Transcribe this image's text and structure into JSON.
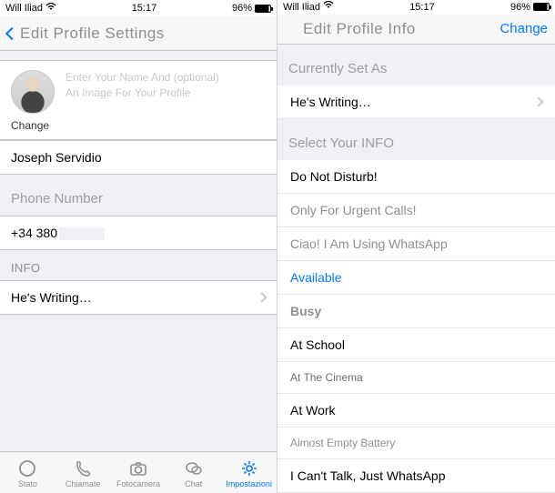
{
  "status": {
    "carrier": "Will Iliad",
    "time": "15:17",
    "battery_pct": "96%"
  },
  "left": {
    "nav_title": "Edit Profile Settings",
    "profile_placeholder_line1": "Enter Your Name And (optional)",
    "profile_placeholder_line2": "An Image For Your Profile",
    "change_label": "Change",
    "name_value": "Joseph Servidio",
    "phone_header": "Phone Number",
    "phone_value": "+34 380",
    "info_header": "INFO",
    "info_value": "He's Writing…"
  },
  "right": {
    "nav_title": "Edit Profile Info",
    "nav_right": "Change",
    "section_current": "Currently Set As",
    "current_value": "He's Writing…",
    "section_select": "Select Your INFO",
    "options": [
      "Do Not Disturb!",
      "Only For Urgent Calls!",
      "Ciao! I Am Using WhatsApp",
      "Available",
      "Busy",
      "At School",
      "At The Cinema",
      "At Work",
      "Almost Empty Battery",
      "I Can't Talk, Just WhatsApp"
    ]
  },
  "tabs": {
    "stato": "Stato",
    "chiamate": "Chiamate",
    "fotocamera": "Fotocamera",
    "chat": "Chat",
    "impostazioni": "Impostazioni"
  }
}
